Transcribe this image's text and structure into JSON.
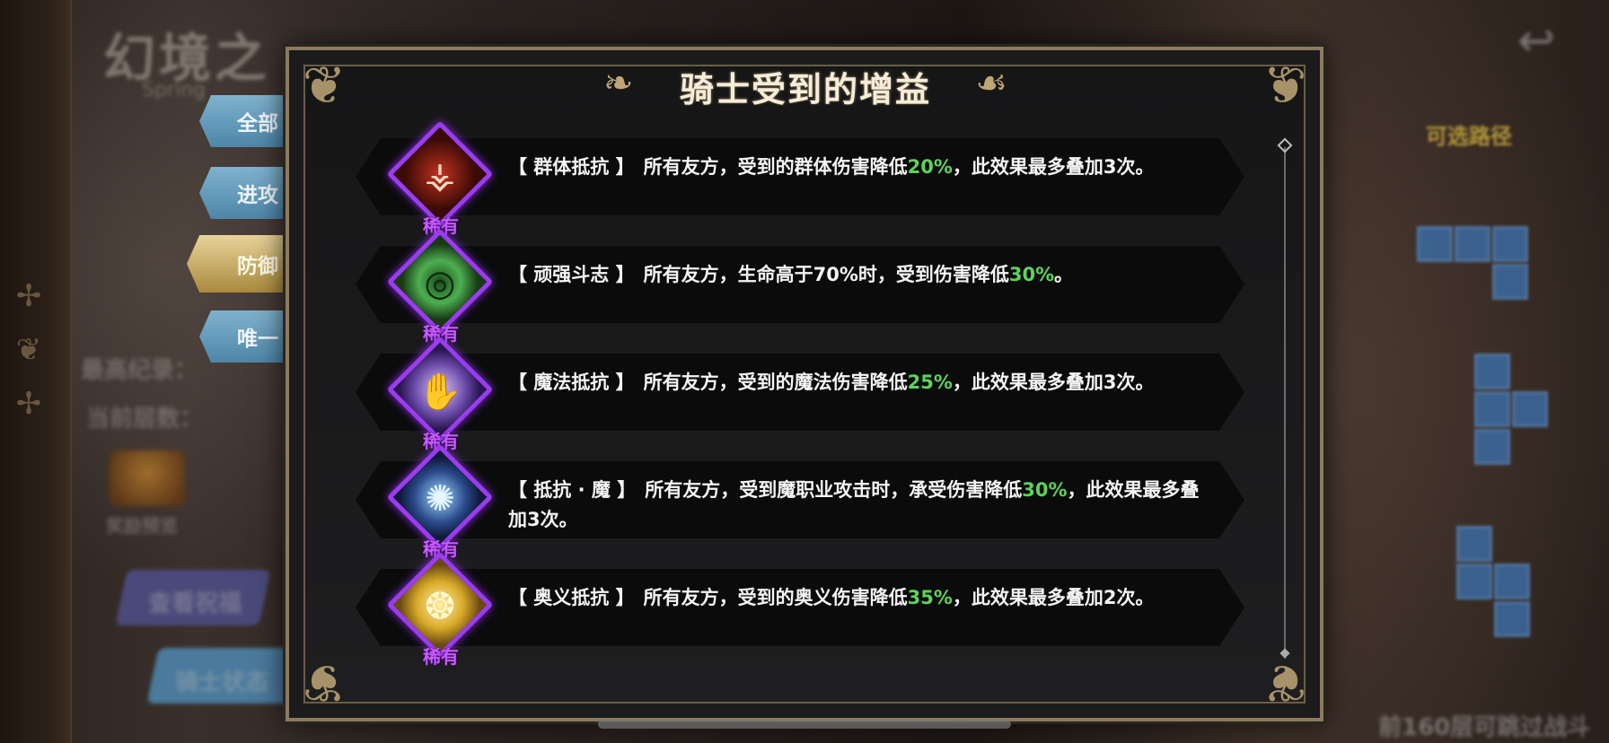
{
  "background": {
    "title": "幻境之",
    "subtitle": "Spring",
    "stats": [
      "最高纪录：",
      "当前层数："
    ],
    "reward_label": "奖励预览",
    "buttons": [
      "查看祝福",
      "骑士状态"
    ],
    "right_label": "可选路径",
    "footer_hint": "前160层可跳过战斗"
  },
  "tabs": [
    {
      "label": "全部",
      "active": false
    },
    {
      "label": "进攻",
      "active": false
    },
    {
      "label": "防御",
      "active": true
    },
    {
      "label": "唯一",
      "active": false
    }
  ],
  "modal": {
    "title": "骑士受到的增益",
    "buffs": [
      {
        "icon": "claw-icon",
        "rarity": "稀有",
        "name": "【 群体抵抗 】",
        "before": "所有友方，受到的群体伤害降低",
        "pct": "20%",
        "after": "，此效果最多叠加3次。"
      },
      {
        "icon": "vortex-icon",
        "rarity": "稀有",
        "name": "【 顽强斗志 】",
        "before": "所有友方，生命高于70%时，受到伤害降低",
        "pct": "30%",
        "after": "。"
      },
      {
        "icon": "magic-hand-icon",
        "rarity": "稀有",
        "name": "【 魔法抵抗 】",
        "before": "所有友方，受到的魔法伤害降低",
        "pct": "25%",
        "after": "，此效果最多叠加3次。"
      },
      {
        "icon": "magic-shield-icon",
        "rarity": "稀有",
        "name": "【 抵抗 · 魔 】",
        "before": "所有友方，受到魔职业攻击时，承受伤害降低",
        "pct": "30%",
        "after": "，此效果最多叠加3次。"
      },
      {
        "icon": "golden-orb-icon",
        "rarity": "稀有",
        "name": "【 奥义抵抗 】",
        "before": "所有友方，受到的奥义伤害降低",
        "pct": "35%",
        "after": "，此效果最多叠加2次。"
      }
    ]
  },
  "colors": {
    "accent_green": "#5ed35a",
    "rarity_purple": "#c75cff",
    "tab_active": "#c9ad62",
    "tab_inactive": "#6a9fbe"
  }
}
